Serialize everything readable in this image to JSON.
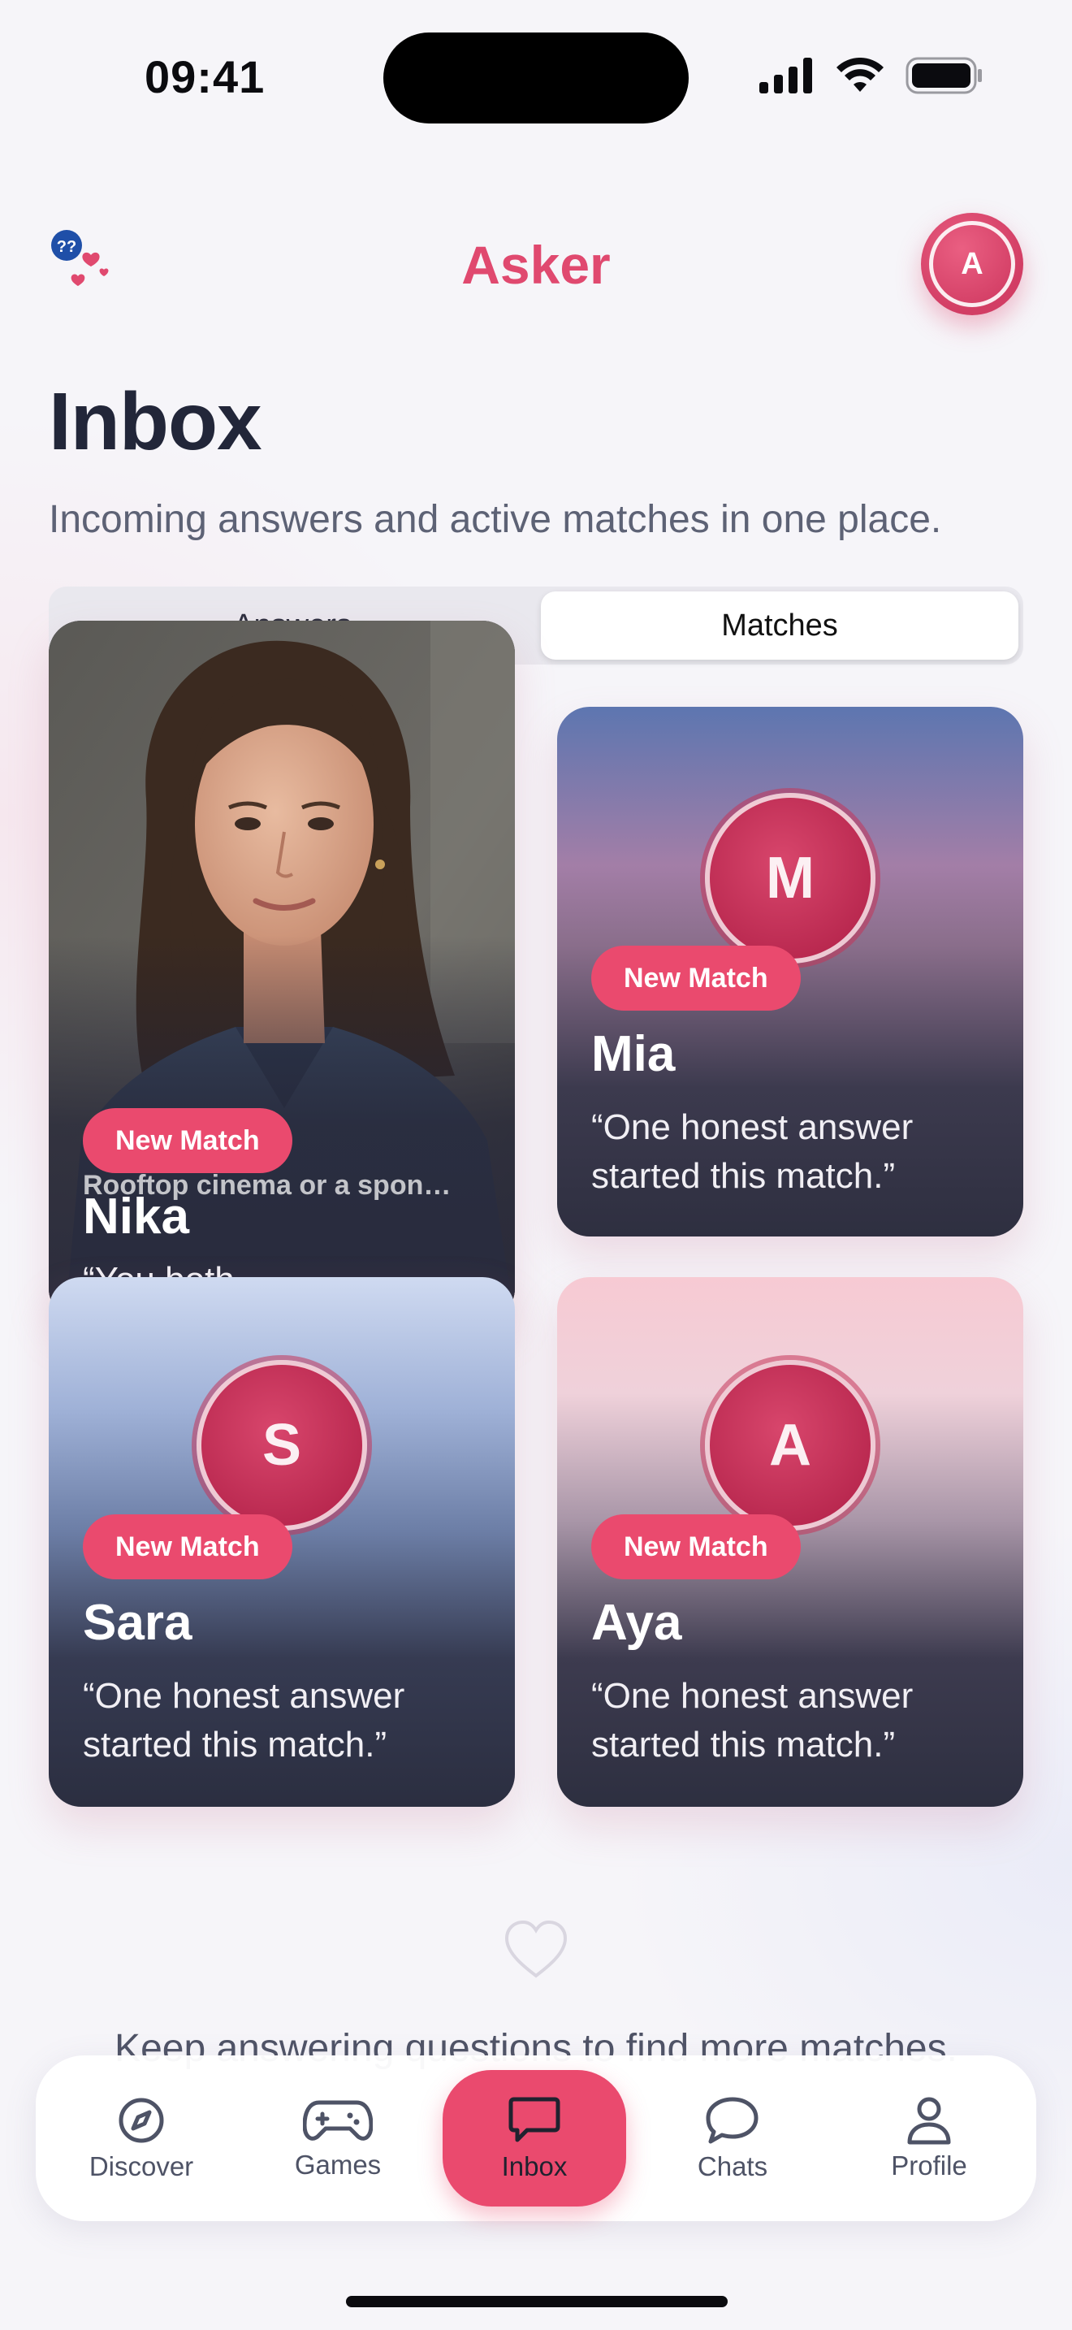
{
  "status_bar": {
    "time": "09:41"
  },
  "header": {
    "app_title": "Asker",
    "avatar_initial": "A"
  },
  "page": {
    "title": "Inbox",
    "subtitle": "Incoming answers and active matches in one place."
  },
  "segments": {
    "left_label": "Answers",
    "right_label": "Matches",
    "selected": "Matches"
  },
  "cards": [
    {
      "name": "Nika",
      "badge": "New Match",
      "quote": "“You both chose humor.”",
      "teaser": "Rooftop cinema or a spon…",
      "has_photo": true
    },
    {
      "name": "Mia",
      "badge": "New Match",
      "initial": "M",
      "quote": "“One honest answer started this match.”"
    },
    {
      "name": "Sara",
      "badge": "New Match",
      "initial": "S",
      "quote": "“One honest answer started this match.”"
    },
    {
      "name": "Aya",
      "badge": "New Match",
      "initial": "A",
      "quote": "“One honest answer started this match.”"
    }
  ],
  "footer": {
    "hint": "Keep answering questions to find more matches."
  },
  "tab_bar": {
    "items": [
      {
        "label": "Discover",
        "icon": "compass-icon"
      },
      {
        "label": "Games",
        "icon": "gamepad-icon"
      },
      {
        "label": "Inbox",
        "icon": "message-square-icon",
        "active": true
      },
      {
        "label": "Chats",
        "icon": "chat-bubble-icon"
      },
      {
        "label": "Profile",
        "icon": "user-icon"
      }
    ]
  },
  "colors": {
    "accent": "#e0496f",
    "badge": "#ea4a6e",
    "text_dark": "#222639",
    "text_muted": "#5d6275"
  }
}
